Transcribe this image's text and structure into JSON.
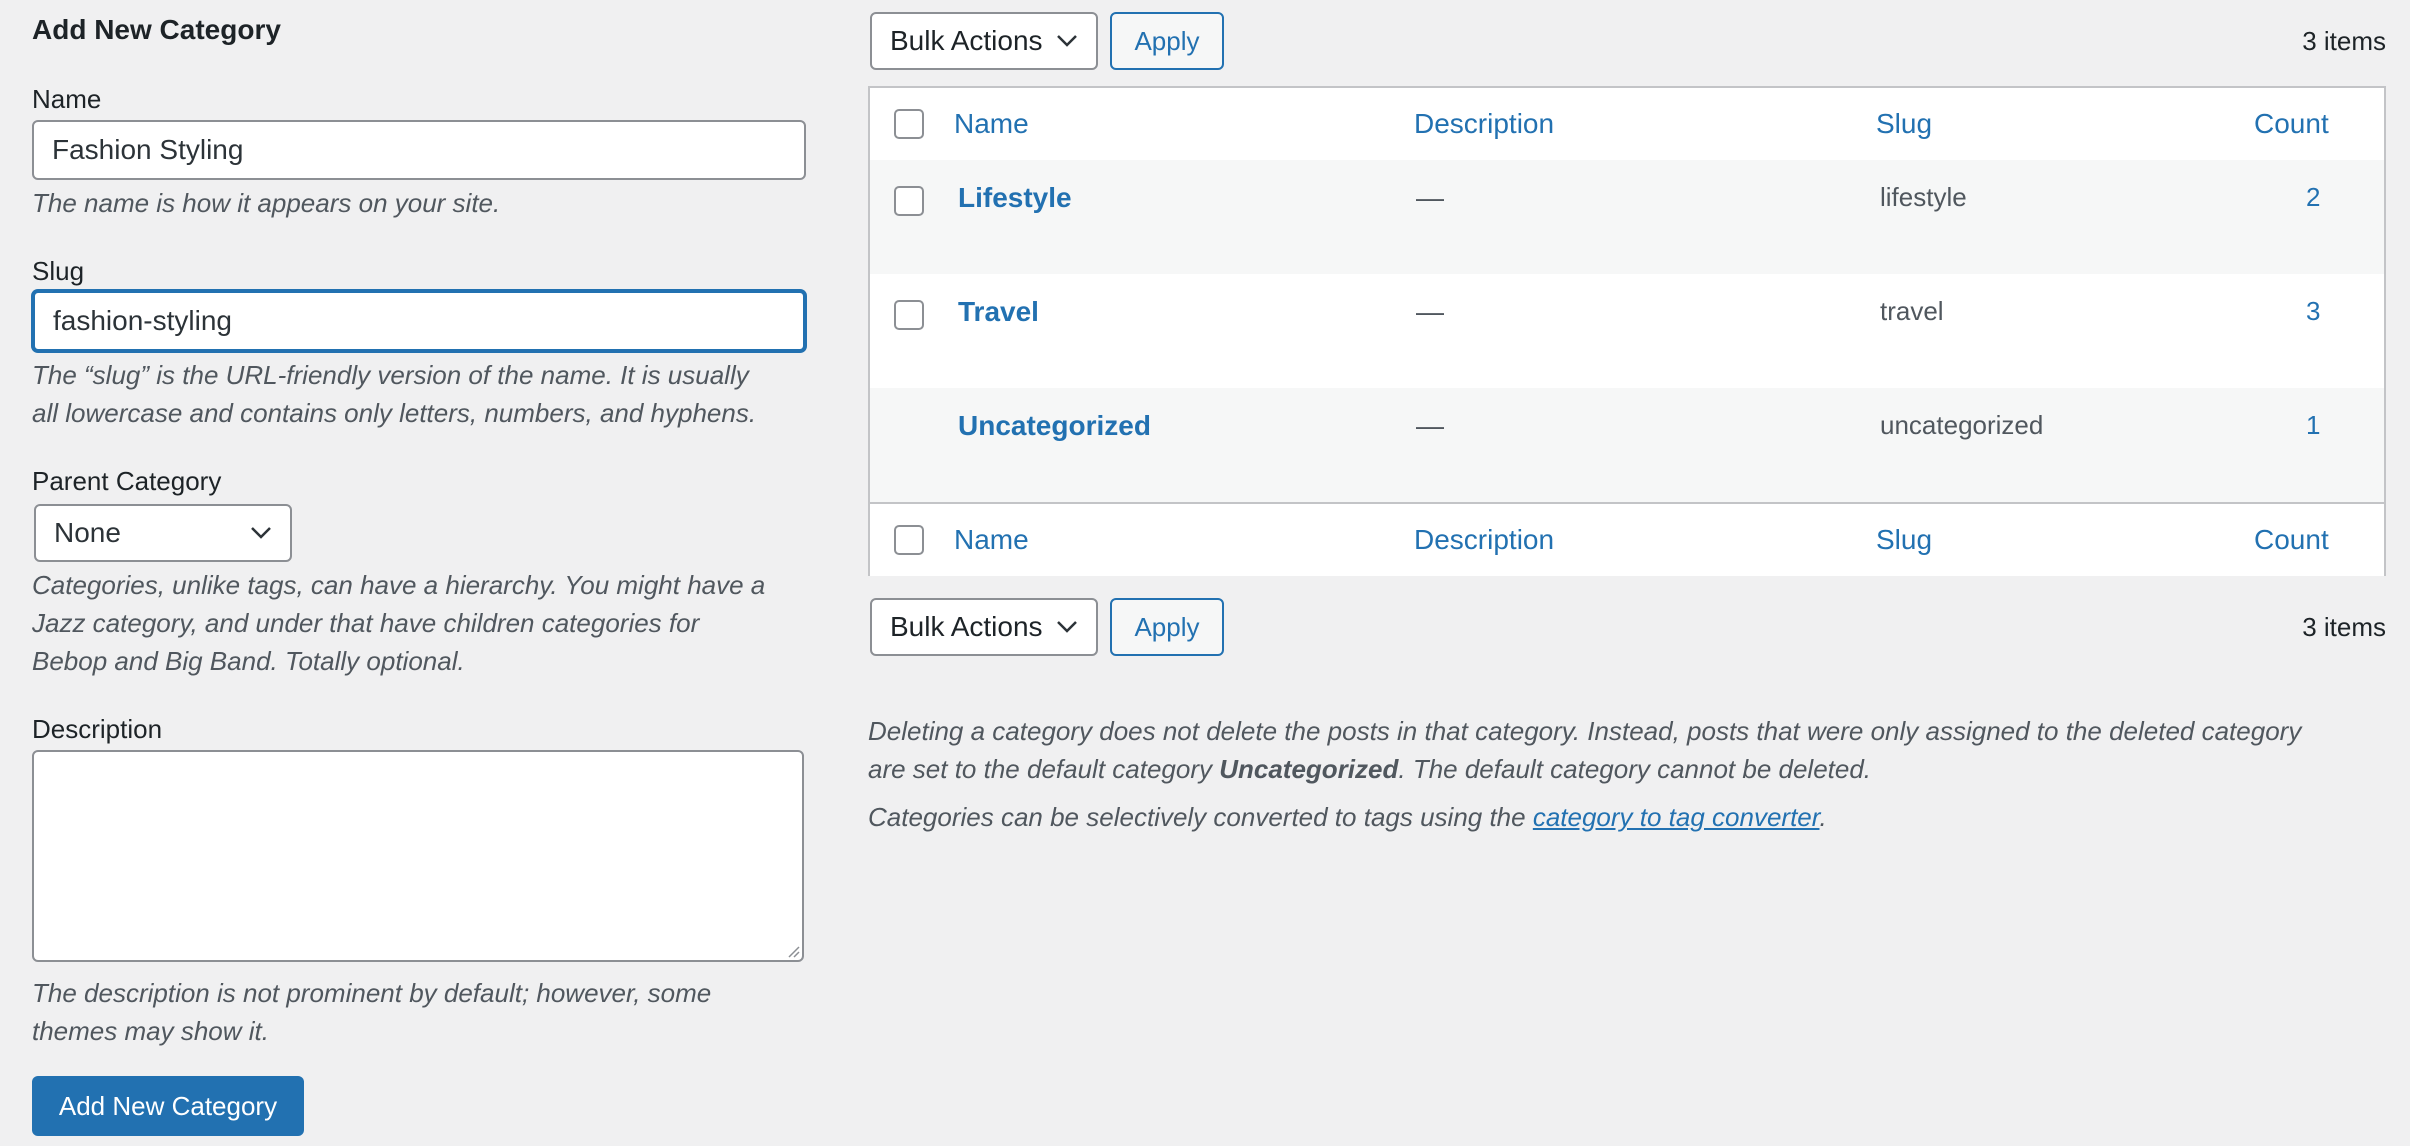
{
  "form": {
    "title": "Add New Category",
    "name_label": "Name",
    "name_value": "Fashion Styling",
    "name_help": "The name is how it appears on your site.",
    "slug_label": "Slug",
    "slug_value": "fashion-styling",
    "slug_help_1": "The “slug” is the URL-friendly version of the name. It is usually",
    "slug_help_2": "all lowercase and contains only letters, numbers, and hyphens.",
    "parent_label": "Parent Category",
    "parent_value": "None",
    "parent_help_1": "Categories, unlike tags, can have a hierarchy. You might have a",
    "parent_help_2": "Jazz category, and under that have children categories for",
    "parent_help_3": "Bebop and Big Band. Totally optional.",
    "description_label": "Description",
    "description_value": "",
    "description_help_1": "The description is not prominent by default; however, some",
    "description_help_2": "themes may show it.",
    "submit_label": "Add New Category"
  },
  "toolbar_top": {
    "bulk_actions": "Bulk Actions",
    "apply": "Apply",
    "items": "3 items"
  },
  "toolbar_bottom": {
    "bulk_actions": "Bulk Actions",
    "apply": "Apply",
    "items": "3 items"
  },
  "table": {
    "columns": {
      "name": "Name",
      "description": "Description",
      "slug": "Slug",
      "count": "Count"
    },
    "rows": [
      {
        "name": "Lifestyle",
        "description": "—",
        "slug": "lifestyle",
        "count": "2"
      },
      {
        "name": "Travel",
        "description": "—",
        "slug": "travel",
        "count": "3"
      },
      {
        "name": "Uncategorized",
        "description": "—",
        "slug": "uncategorized",
        "count": "1"
      }
    ]
  },
  "notes": {
    "line1": "Deleting a category does not delete the posts in that category. Instead, posts that were only assigned to the deleted category",
    "line2_pre": "are set to the default category ",
    "line2_bold": "Uncategorized",
    "line2_post": ". The default category cannot be deleted.",
    "line3_pre": "Categories can be selectively converted to tags using the ",
    "line3_link": "category to tag converter",
    "line3_post": "."
  },
  "colors": {
    "accent": "#2271b1",
    "background": "#f0f0f1",
    "border": "#c3c4c7"
  }
}
